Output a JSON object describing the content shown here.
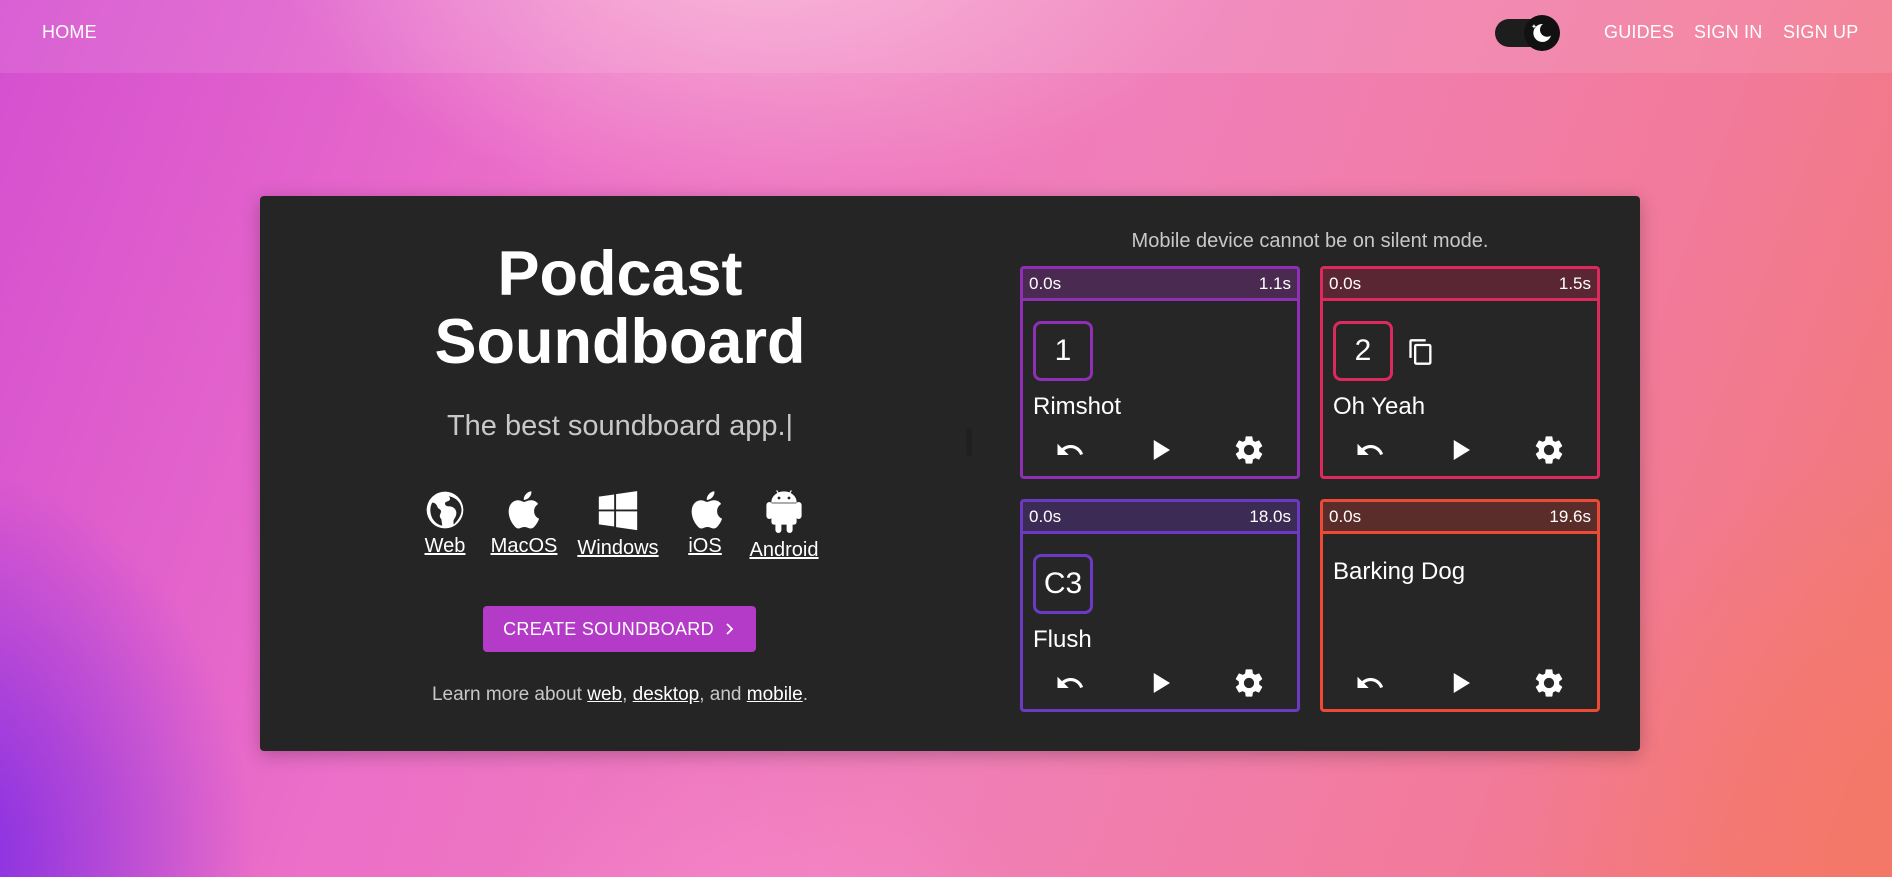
{
  "nav": {
    "home": "HOME",
    "guides": "GUIDES",
    "sign_in": "SIGN IN",
    "sign_up": "SIGN UP"
  },
  "hero": {
    "title_line1": "Podcast",
    "title_line2": "Soundboard",
    "subtitle": "The best soundboard app.|",
    "platforms": [
      "Web",
      "MacOS",
      "Windows",
      "iOS",
      "Android"
    ],
    "cta": "CREATE SOUNDBOARD",
    "learn_prefix": "Learn more about ",
    "learn_web": "web",
    "learn_sep1": ", ",
    "learn_desktop": "desktop",
    "learn_sep2": ", and ",
    "learn_mobile": "mobile",
    "learn_suffix": "."
  },
  "board": {
    "notice": "Mobile device cannot be on silent mode.",
    "tiles": [
      {
        "start": "0.0s",
        "duration": "1.1s",
        "key": "1",
        "name": "Rimshot",
        "color": "#8e2fb4",
        "bar_bg": "#4b2a52"
      },
      {
        "start": "0.0s",
        "duration": "1.5s",
        "key": "2",
        "name": "Oh Yeah",
        "color": "#dc2a5e",
        "bar_bg": "#5a2634"
      },
      {
        "start": "0.0s",
        "duration": "18.0s",
        "key": "C3",
        "name": "Flush",
        "color": "#6c3ac2",
        "bar_bg": "#3c2b54"
      },
      {
        "start": "0.0s",
        "duration": "19.6s",
        "key": "",
        "name": "Barking Dog",
        "color": "#ea4a36",
        "bar_bg": "#5a2c2a"
      }
    ]
  },
  "colors": {
    "card_bg": "#252525",
    "cta_bg": "#b43bc7"
  }
}
